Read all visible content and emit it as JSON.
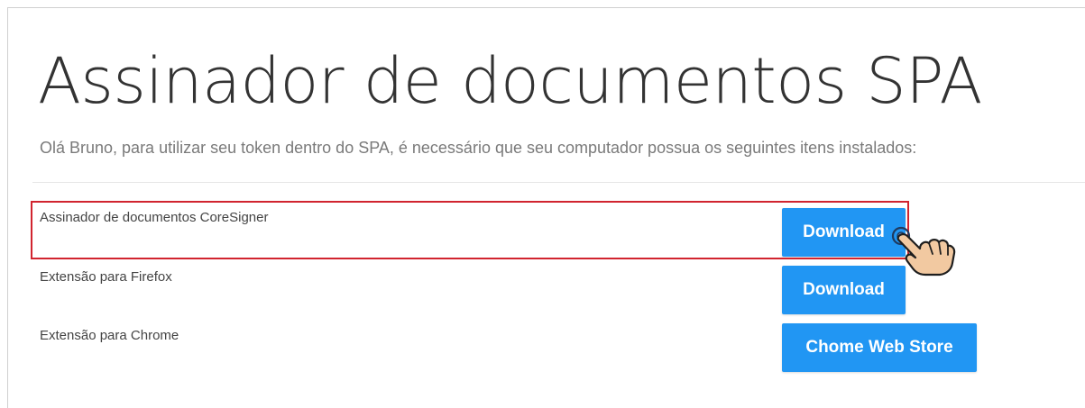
{
  "page": {
    "title": "Assinador de documentos SPA",
    "subtitle": "Olá Bruno, para utilizar seu token dentro do SPA, é necessário que seu computador possua os seguintes itens instalados:"
  },
  "items": [
    {
      "label": "Assinador de documentos CoreSigner",
      "button": "Download"
    },
    {
      "label": "Extensão para Firefox",
      "button": "Download"
    },
    {
      "label": "Extensão para Chrome",
      "button": "Chome Web Store"
    }
  ],
  "annotations": {
    "highlight_color": "#d1242f",
    "pointer": "hand-pointer-icon"
  },
  "colors": {
    "button": "#2196f3",
    "title": "#333333",
    "subtitle": "#7a7a7a"
  }
}
